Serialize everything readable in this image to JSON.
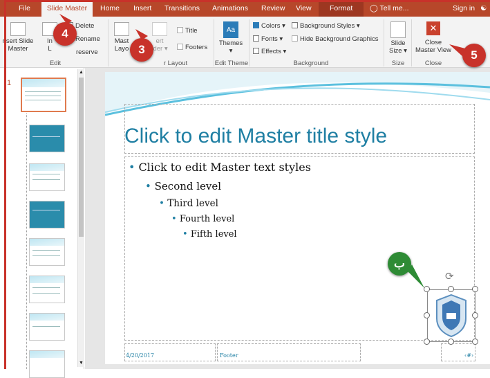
{
  "tabs": [
    "File",
    "Slide Master",
    "Home",
    "Insert",
    "Transitions",
    "Animations",
    "Review",
    "View",
    "Format"
  ],
  "tell_me": "Tell me...",
  "sign_in": "Sign in",
  "ribbon": {
    "insert_slide_master": [
      "nsert Slide",
      "Master"
    ],
    "insert_layout": [
      "In",
      "L"
    ],
    "delete": "Delete",
    "rename": "Rename",
    "preserve": "reserve",
    "edit_master_group": "Edit",
    "master_layout": [
      "Mast",
      "Layo"
    ],
    "insert_placeholder": [
      "ert",
      "lder ▾"
    ],
    "title_chk": "Title",
    "footers_chk": "Footers",
    "master_layout_group": "r Layout",
    "themes": "Themes",
    "edit_theme_group": "Edit Theme",
    "colors": "Colors ▾",
    "fonts": "Fonts ▾",
    "effects": "Effects ▾",
    "background_styles": "Background Styles ▾",
    "hide_bg": "Hide Background Graphics",
    "background_group": "Background",
    "slide_size": [
      "Slide",
      "Size ▾"
    ],
    "size_group": "Size",
    "close_master_view": [
      "Close",
      "Master View"
    ],
    "close_group": "Close"
  },
  "slide_number": "1",
  "slide": {
    "title": "Click to edit Master title style",
    "levels": [
      "Click to edit Master text styles",
      "Second level",
      "Third level",
      "Fourth level",
      "Fifth level"
    ],
    "date": "4/20/2017",
    "footer": "Footer",
    "number": "‹#›"
  },
  "badges": [
    "4",
    "3",
    "5",
    "ب"
  ],
  "colors": {
    "accent": "#b7472a",
    "badge_red": "#c8322a",
    "badge_green": "#2e8b35",
    "title_blue": "#1f7fa3"
  }
}
